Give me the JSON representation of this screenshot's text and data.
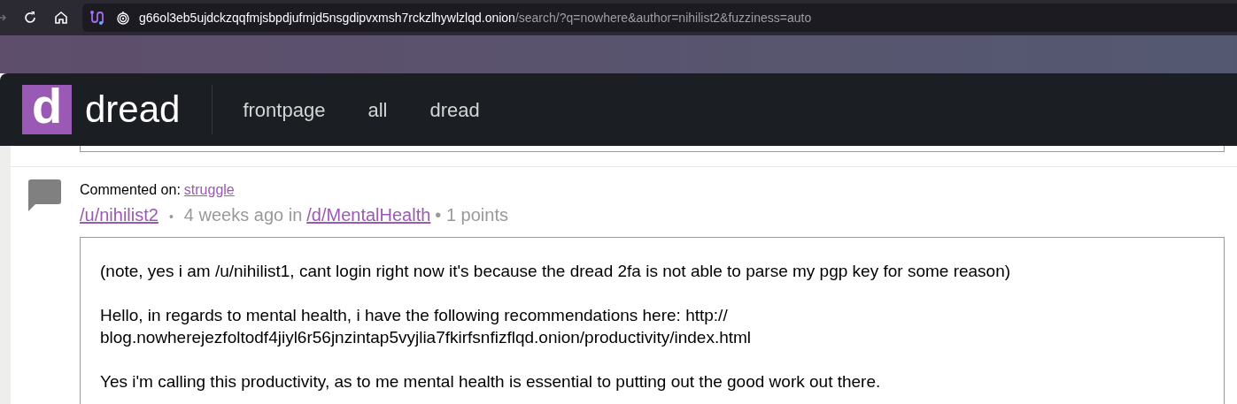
{
  "browser": {
    "url_host": "g66ol3eb5ujdckzqqfmjsbpdjufmjd5nsgdipvxmsh7rckzlhywlzlqd.onion",
    "url_path": "/search/?q=nowhere&author=nihilist2&fuzziness=auto"
  },
  "header": {
    "logo_letter": "d",
    "site_name": "dread",
    "nav": [
      "frontpage",
      "all",
      "dread"
    ]
  },
  "comment": {
    "commented_on_label": "Commented on:",
    "post_link": "struggle",
    "author": "/u/nihilist2",
    "separator": "•",
    "age": "4 weeks ago in",
    "community": "/d/MentalHealth",
    "points": "• 1 points",
    "paragraphs": [
      {
        "lines": [
          "(note, yes i am /u/nihilist1, cant login right now it's because the dread 2fa is not able to parse my pgp key for some reason)"
        ]
      },
      {
        "lines": [
          "Hello, in regards to mental health, i have the following recommendations here: http://",
          "blog.nowherejezfoltodf4jiyl6r56jnzintap5vyjlia7fkirfsnfizflqd.onion/productivity/index.html"
        ]
      },
      {
        "lines": [
          "Yes i'm calling this productivity, as to me mental health is essential to putting out the good work out there."
        ]
      }
    ]
  }
}
